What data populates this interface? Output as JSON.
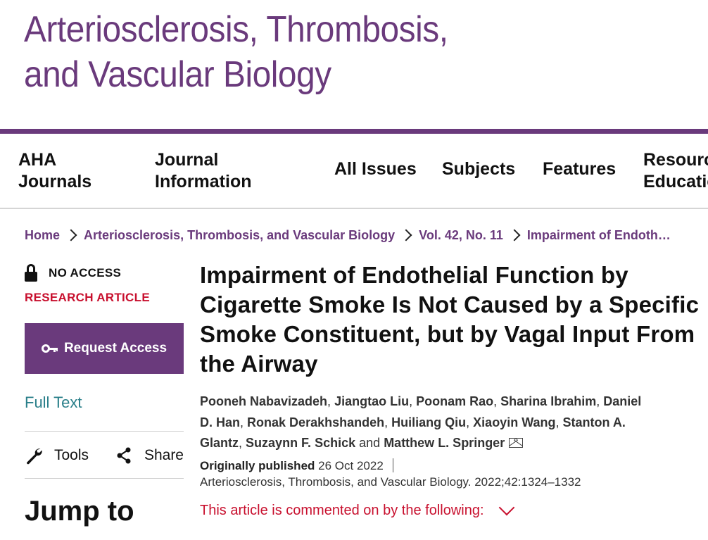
{
  "masthead": {
    "title_line1": "Arteriosclerosis, Thrombosis,",
    "title_line2": "and Vascular Biology"
  },
  "nav": {
    "items": [
      {
        "label1": "AHA",
        "label2": "Journals"
      },
      {
        "label1": "Journal",
        "label2": "Information"
      },
      {
        "label": "All Issues"
      },
      {
        "label": "Subjects"
      },
      {
        "label": "Features"
      },
      {
        "label1": "Resources",
        "label2": "Education"
      }
    ]
  },
  "breadcrumb": {
    "items": [
      "Home",
      "Arteriosclerosis, Thrombosis, and Vascular Biology",
      "Vol. 42, No. 11",
      "Impairment of Endothelial Function by Cigarette Smoke Is Not Caused by a Specific Smoke Constituent, but by Vagal Input From the Airway"
    ]
  },
  "sidebar": {
    "access_label": "NO ACCESS",
    "article_type": "RESEARCH ARTICLE",
    "request_access_label": "Request Access",
    "full_text_label": "Full Text",
    "tools_label": "Tools",
    "share_label": "Share",
    "jump_to_label": "Jump to"
  },
  "article": {
    "title": "Impairment of Endothelial Function by Cigarette Smoke Is Not Caused by a Specific Smoke Constituent, but by Vagal Input From the Airway",
    "authors": [
      "Pooneh Nabavizadeh",
      "Jiangtao Liu",
      "Poonam Rao",
      "Sharina Ibrahim",
      "Daniel D. Han",
      "Ronak Derakhshandeh",
      "Huiliang Qiu",
      "Xiaoyin Wang",
      "Stanton A. Glantz",
      "Suzaynn F. Schick",
      "Matthew L. Springer"
    ],
    "author_separator": ",",
    "author_conjunction": "and",
    "published_label": "Originally published",
    "published_date": "26 Oct 2022",
    "citation": "Arteriosclerosis, Thrombosis, and Vascular Biology. 2022;42:1324–1332",
    "commented_label": "This article is commented on by the following:"
  },
  "colors": {
    "brand_purple": "#6a3a7c",
    "accent_red": "#c8102e",
    "link_teal": "#2a7f8a"
  },
  "icons": [
    "lock-icon",
    "key-icon",
    "wrench-icon",
    "share-icon",
    "mail-icon",
    "chevron-right-icon",
    "chevron-down-icon"
  ]
}
